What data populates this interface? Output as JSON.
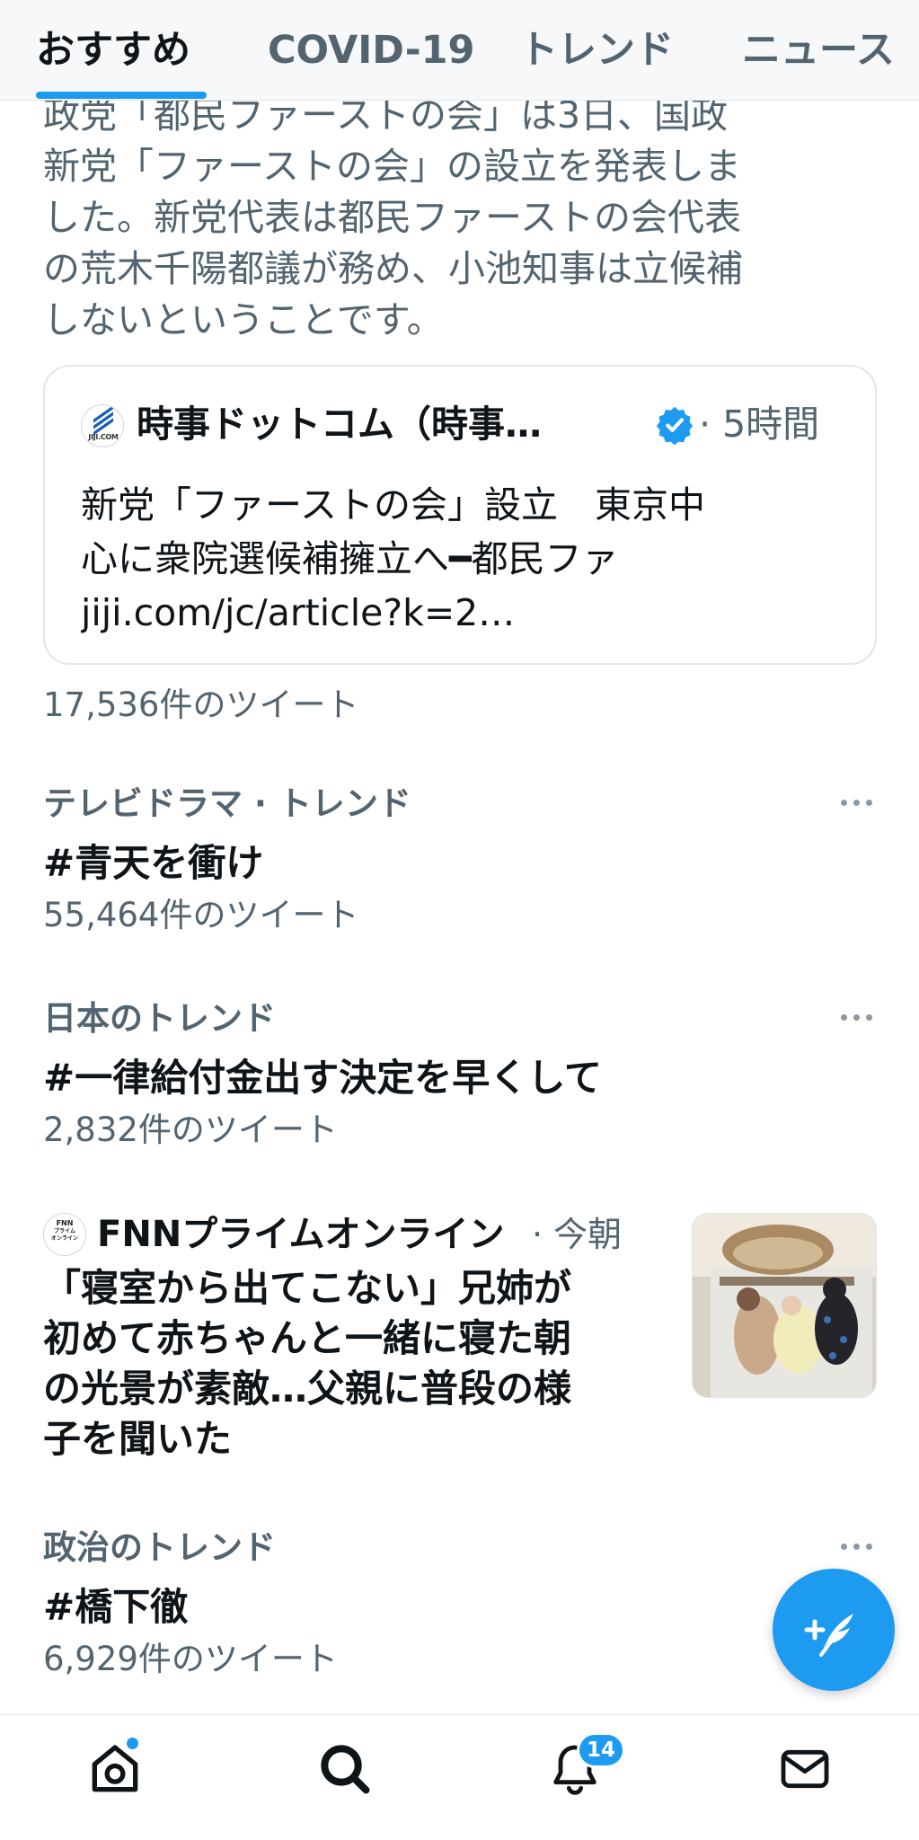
{
  "tabs": [
    {
      "label": "おすすめ",
      "active": true
    },
    {
      "label": "COVID-19",
      "active": false
    },
    {
      "label": "トレンド",
      "active": false
    },
    {
      "label": "ニュース",
      "active": false
    }
  ],
  "summary_text": "政党「都民ファーストの会」は3日、国政\n新党「ファーストの会」の設立を発表しま\nした。新党代表は都民ファーストの会代表\nの荒木千陽都議が務め、小池知事は立候補\nしないということです。",
  "card": {
    "logo_text": "JIJI.COM",
    "source": "時事ドットコム（時事…",
    "verified_icon": "verified-badge-icon",
    "time": "· 5時間",
    "body_lines": [
      "新党「ファーストの会」設立　東京中",
      "心に衆院選候補擁立へ━都民ファ",
      "jiji.com/jc/article?k=2…"
    ]
  },
  "card_tweet_count": "17,536件のツイート",
  "trends": [
    {
      "context": "テレビドラマ · トレンド",
      "title": "#青天を衝け",
      "count": "55,464件のツイート"
    },
    {
      "context": "日本のトレンド",
      "title": "#一律給付金出す決定を早くして",
      "count": "2,832件のツイート"
    },
    {
      "context": "政治のトレンド",
      "title": "#橋下徹",
      "count": "6,929件のツイート"
    }
  ],
  "news": {
    "logo_lines": [
      "FNN",
      "プライム",
      "オンライン"
    ],
    "source": "FNNプライムオンライン",
    "time": "· 今朝",
    "headline_lines": [
      "「寝室から出てこない」兄姉が",
      "初めて赤ちゃんと一緒に寝た朝",
      "の光景が素敵…父親に普段の様",
      "子を聞いた"
    ]
  },
  "bottom_nav": {
    "items": [
      "home-icon",
      "search-icon",
      "notifications-icon",
      "messages-icon"
    ],
    "notification_badge": "14"
  },
  "colors": {
    "accent": "#1d9bf0",
    "text_primary": "#0f1419",
    "text_secondary": "#536471"
  }
}
